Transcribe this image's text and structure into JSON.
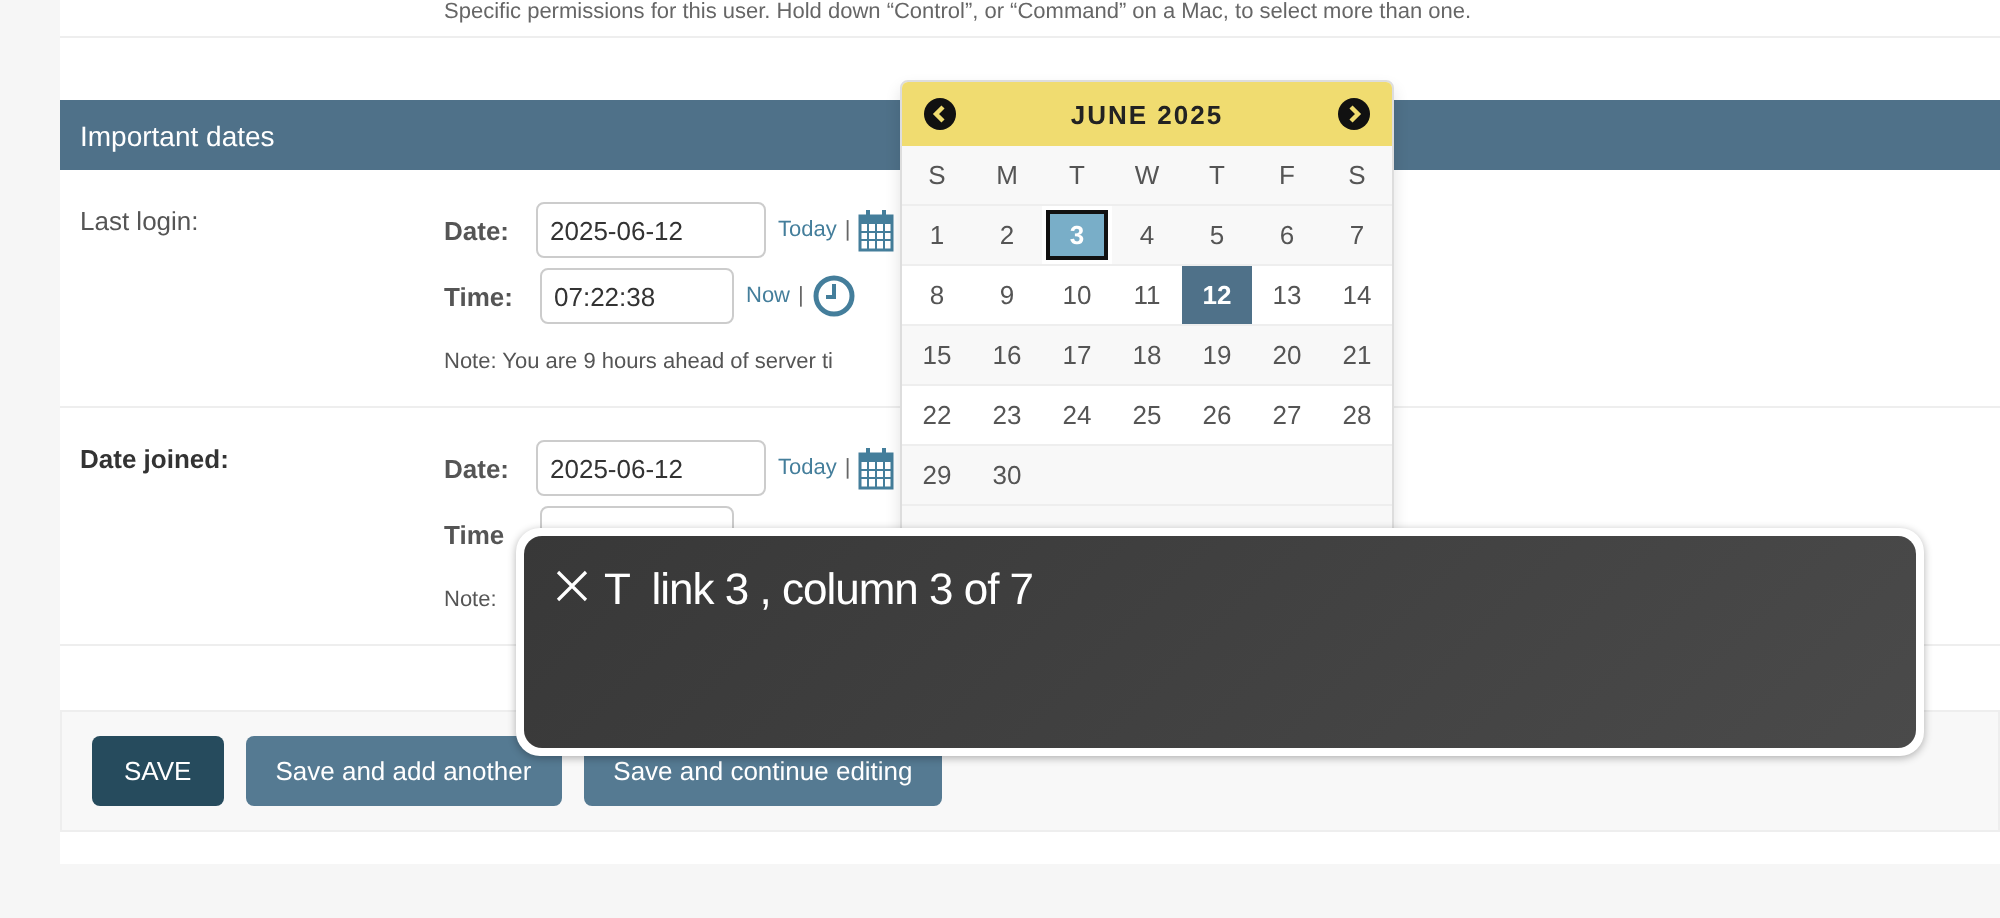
{
  "intro_text": "Specific permissions for this user. Hold down “Control”, or “Command” on a Mac, to select more than one.",
  "fieldset": {
    "title": "Important dates",
    "rows": [
      {
        "label": "Last login:",
        "required": false,
        "date": {
          "label": "Date:",
          "value": "2025-06-12",
          "link": "Today",
          "separator": "|"
        },
        "time": {
          "label": "Time:",
          "value": "07:22:38",
          "link": "Now",
          "separator": "|"
        },
        "note": "Note: You are 9 hours ahead of server ti"
      },
      {
        "label": "Date joined:",
        "required": true,
        "date": {
          "label": "Date:",
          "value": "2025-06-12",
          "link": "Today",
          "separator": "|"
        },
        "time": {
          "label": "Time"
        },
        "note": "Note:"
      }
    ]
  },
  "calendar": {
    "title": "JUNE 2025",
    "weekdays": [
      "S",
      "M",
      "T",
      "W",
      "T",
      "F",
      "S"
    ],
    "weeks": [
      [
        {
          "day": "1",
          "selected": false,
          "focused": false
        },
        {
          "day": "2",
          "selected": false,
          "focused": false
        },
        {
          "day": "3",
          "selected": false,
          "focused": true
        },
        {
          "day": "4",
          "selected": false,
          "focused": false
        },
        {
          "day": "5",
          "selected": false,
          "focused": false
        },
        {
          "day": "6",
          "selected": false,
          "focused": false
        },
        {
          "day": "7",
          "selected": false,
          "focused": false
        }
      ],
      [
        {
          "day": "8",
          "selected": false,
          "focused": false
        },
        {
          "day": "9",
          "selected": false,
          "focused": false
        },
        {
          "day": "10",
          "selected": false,
          "focused": false
        },
        {
          "day": "11",
          "selected": false,
          "focused": false
        },
        {
          "day": "12",
          "selected": true,
          "focused": false
        },
        {
          "day": "13",
          "selected": false,
          "focused": false
        },
        {
          "day": "14",
          "selected": false,
          "focused": false
        }
      ],
      [
        {
          "day": "15",
          "selected": false,
          "focused": false
        },
        {
          "day": "16",
          "selected": false,
          "focused": false
        },
        {
          "day": "17",
          "selected": false,
          "focused": false
        },
        {
          "day": "18",
          "selected": false,
          "focused": false
        },
        {
          "day": "19",
          "selected": false,
          "focused": false
        },
        {
          "day": "20",
          "selected": false,
          "focused": false
        },
        {
          "day": "21",
          "selected": false,
          "focused": false
        }
      ],
      [
        {
          "day": "22",
          "selected": false,
          "focused": false
        },
        {
          "day": "23",
          "selected": false,
          "focused": false
        },
        {
          "day": "24",
          "selected": false,
          "focused": false
        },
        {
          "day": "25",
          "selected": false,
          "focused": false
        },
        {
          "day": "26",
          "selected": false,
          "focused": false
        },
        {
          "day": "27",
          "selected": false,
          "focused": false
        },
        {
          "day": "28",
          "selected": false,
          "focused": false
        }
      ],
      [
        {
          "day": "29",
          "selected": false,
          "focused": false
        },
        {
          "day": "30",
          "selected": false,
          "focused": false
        }
      ]
    ]
  },
  "buttons": [
    {
      "label": "SAVE",
      "kind": "default"
    },
    {
      "label": "Save and add another",
      "kind": "secondary"
    },
    {
      "label": "Save and continue editing",
      "kind": "secondary"
    }
  ],
  "voiceover": {
    "text": "T  link 3 , column 3 of 7"
  }
}
